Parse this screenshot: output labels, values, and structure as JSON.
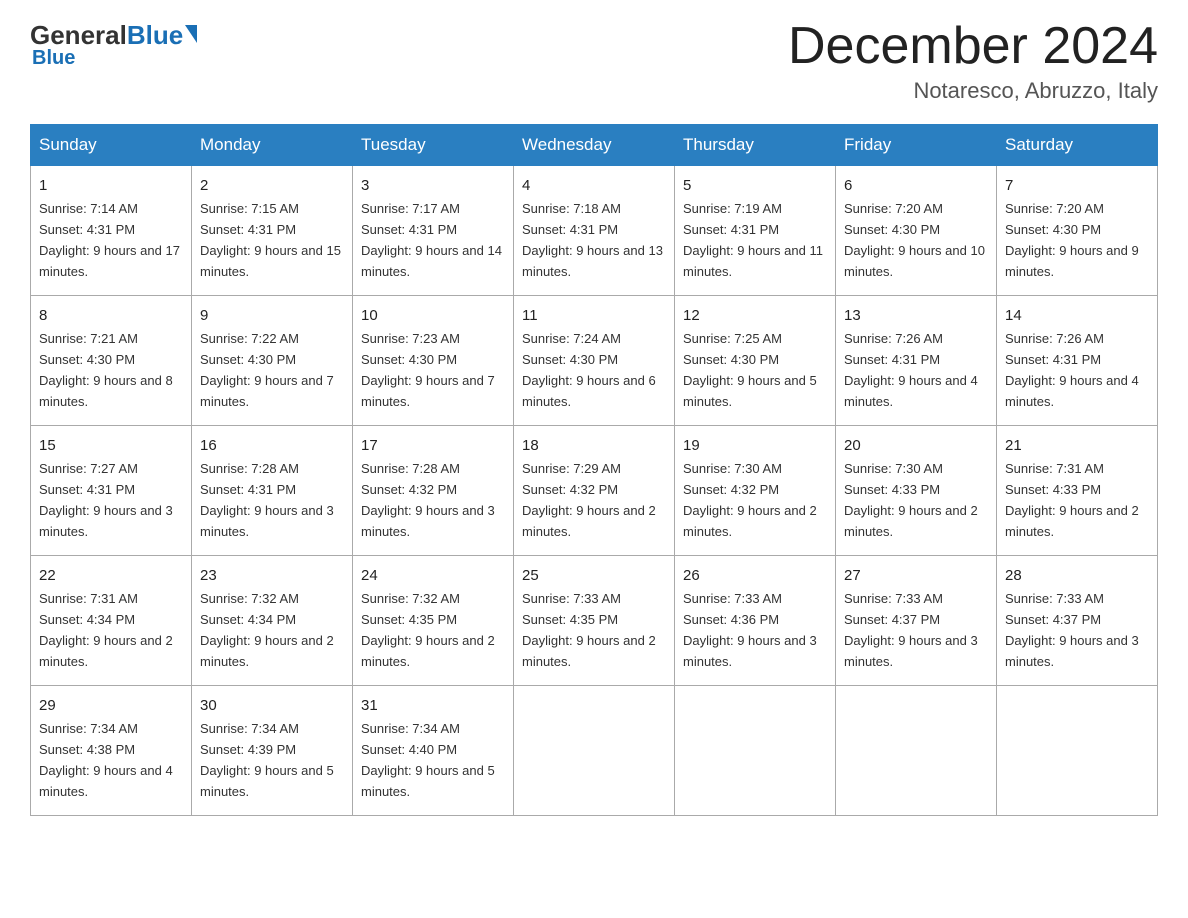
{
  "logo": {
    "general": "General",
    "blue": "Blue"
  },
  "header": {
    "month": "December 2024",
    "location": "Notaresco, Abruzzo, Italy"
  },
  "days_of_week": [
    "Sunday",
    "Monday",
    "Tuesday",
    "Wednesday",
    "Thursday",
    "Friday",
    "Saturday"
  ],
  "weeks": [
    [
      {
        "num": "1",
        "rise": "7:14 AM",
        "set": "4:31 PM",
        "daylight": "9 hours and 17 minutes."
      },
      {
        "num": "2",
        "rise": "7:15 AM",
        "set": "4:31 PM",
        "daylight": "9 hours and 15 minutes."
      },
      {
        "num": "3",
        "rise": "7:17 AM",
        "set": "4:31 PM",
        "daylight": "9 hours and 14 minutes."
      },
      {
        "num": "4",
        "rise": "7:18 AM",
        "set": "4:31 PM",
        "daylight": "9 hours and 13 minutes."
      },
      {
        "num": "5",
        "rise": "7:19 AM",
        "set": "4:31 PM",
        "daylight": "9 hours and 11 minutes."
      },
      {
        "num": "6",
        "rise": "7:20 AM",
        "set": "4:30 PM",
        "daylight": "9 hours and 10 minutes."
      },
      {
        "num": "7",
        "rise": "7:20 AM",
        "set": "4:30 PM",
        "daylight": "9 hours and 9 minutes."
      }
    ],
    [
      {
        "num": "8",
        "rise": "7:21 AM",
        "set": "4:30 PM",
        "daylight": "9 hours and 8 minutes."
      },
      {
        "num": "9",
        "rise": "7:22 AM",
        "set": "4:30 PM",
        "daylight": "9 hours and 7 minutes."
      },
      {
        "num": "10",
        "rise": "7:23 AM",
        "set": "4:30 PM",
        "daylight": "9 hours and 7 minutes."
      },
      {
        "num": "11",
        "rise": "7:24 AM",
        "set": "4:30 PM",
        "daylight": "9 hours and 6 minutes."
      },
      {
        "num": "12",
        "rise": "7:25 AM",
        "set": "4:30 PM",
        "daylight": "9 hours and 5 minutes."
      },
      {
        "num": "13",
        "rise": "7:26 AM",
        "set": "4:31 PM",
        "daylight": "9 hours and 4 minutes."
      },
      {
        "num": "14",
        "rise": "7:26 AM",
        "set": "4:31 PM",
        "daylight": "9 hours and 4 minutes."
      }
    ],
    [
      {
        "num": "15",
        "rise": "7:27 AM",
        "set": "4:31 PM",
        "daylight": "9 hours and 3 minutes."
      },
      {
        "num": "16",
        "rise": "7:28 AM",
        "set": "4:31 PM",
        "daylight": "9 hours and 3 minutes."
      },
      {
        "num": "17",
        "rise": "7:28 AM",
        "set": "4:32 PM",
        "daylight": "9 hours and 3 minutes."
      },
      {
        "num": "18",
        "rise": "7:29 AM",
        "set": "4:32 PM",
        "daylight": "9 hours and 2 minutes."
      },
      {
        "num": "19",
        "rise": "7:30 AM",
        "set": "4:32 PM",
        "daylight": "9 hours and 2 minutes."
      },
      {
        "num": "20",
        "rise": "7:30 AM",
        "set": "4:33 PM",
        "daylight": "9 hours and 2 minutes."
      },
      {
        "num": "21",
        "rise": "7:31 AM",
        "set": "4:33 PM",
        "daylight": "9 hours and 2 minutes."
      }
    ],
    [
      {
        "num": "22",
        "rise": "7:31 AM",
        "set": "4:34 PM",
        "daylight": "9 hours and 2 minutes."
      },
      {
        "num": "23",
        "rise": "7:32 AM",
        "set": "4:34 PM",
        "daylight": "9 hours and 2 minutes."
      },
      {
        "num": "24",
        "rise": "7:32 AM",
        "set": "4:35 PM",
        "daylight": "9 hours and 2 minutes."
      },
      {
        "num": "25",
        "rise": "7:33 AM",
        "set": "4:35 PM",
        "daylight": "9 hours and 2 minutes."
      },
      {
        "num": "26",
        "rise": "7:33 AM",
        "set": "4:36 PM",
        "daylight": "9 hours and 3 minutes."
      },
      {
        "num": "27",
        "rise": "7:33 AM",
        "set": "4:37 PM",
        "daylight": "9 hours and 3 minutes."
      },
      {
        "num": "28",
        "rise": "7:33 AM",
        "set": "4:37 PM",
        "daylight": "9 hours and 3 minutes."
      }
    ],
    [
      {
        "num": "29",
        "rise": "7:34 AM",
        "set": "4:38 PM",
        "daylight": "9 hours and 4 minutes."
      },
      {
        "num": "30",
        "rise": "7:34 AM",
        "set": "4:39 PM",
        "daylight": "9 hours and 5 minutes."
      },
      {
        "num": "31",
        "rise": "7:34 AM",
        "set": "4:40 PM",
        "daylight": "9 hours and 5 minutes."
      },
      null,
      null,
      null,
      null
    ]
  ]
}
